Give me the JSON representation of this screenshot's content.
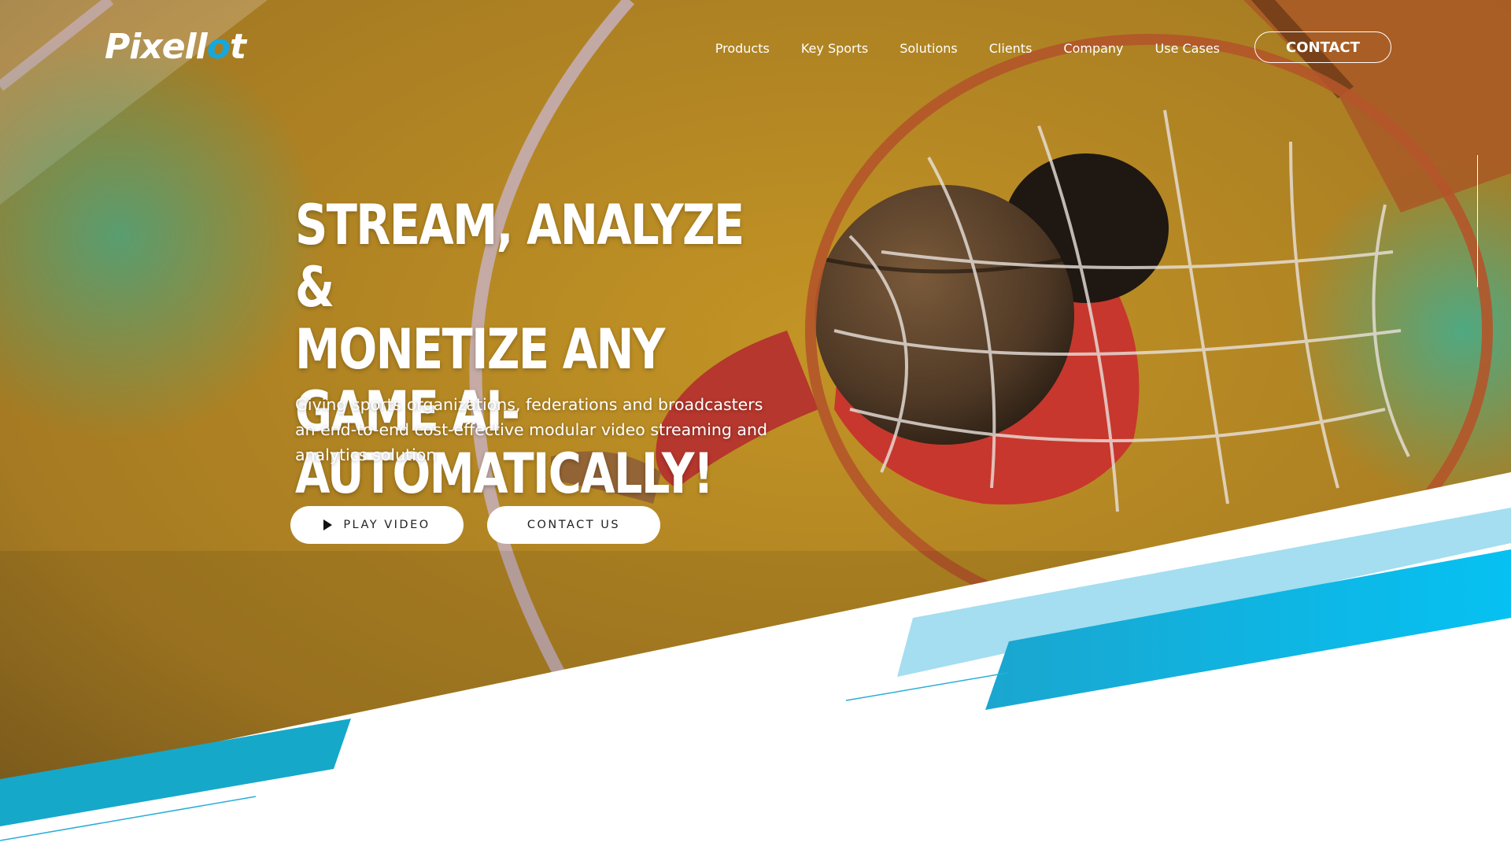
{
  "brand": {
    "logo_main": "Pixell",
    "logo_accent": "o",
    "logo_end": "t",
    "accent_color": "#16a8dd"
  },
  "nav": {
    "items": [
      {
        "label": "Products"
      },
      {
        "label": "Key Sports"
      },
      {
        "label": "Solutions"
      },
      {
        "label": "Clients"
      },
      {
        "label": "Company"
      },
      {
        "label": "Use Cases"
      }
    ],
    "contact_label": "CONTACT"
  },
  "hero": {
    "headline_line1": "STREAM, ANALYZE &",
    "headline_line2": "MONETIZE ANY GAME AI-",
    "headline_line3": "AUTOMATICALLY!",
    "subhead": "Giving sports organizations, federations and broadcasters an end-to-end cost-effective modular video streaming and analytics solution",
    "play_video_label": "PLAY VIDEO",
    "contact_us_label": "CONTACT US",
    "background": "basketball-hoop-overhead",
    "play_icon": "play-icon"
  },
  "colors": {
    "court": "#b78a25",
    "stripe_cyan": "#16a8dd",
    "stripe_light": "#9fdcef"
  }
}
